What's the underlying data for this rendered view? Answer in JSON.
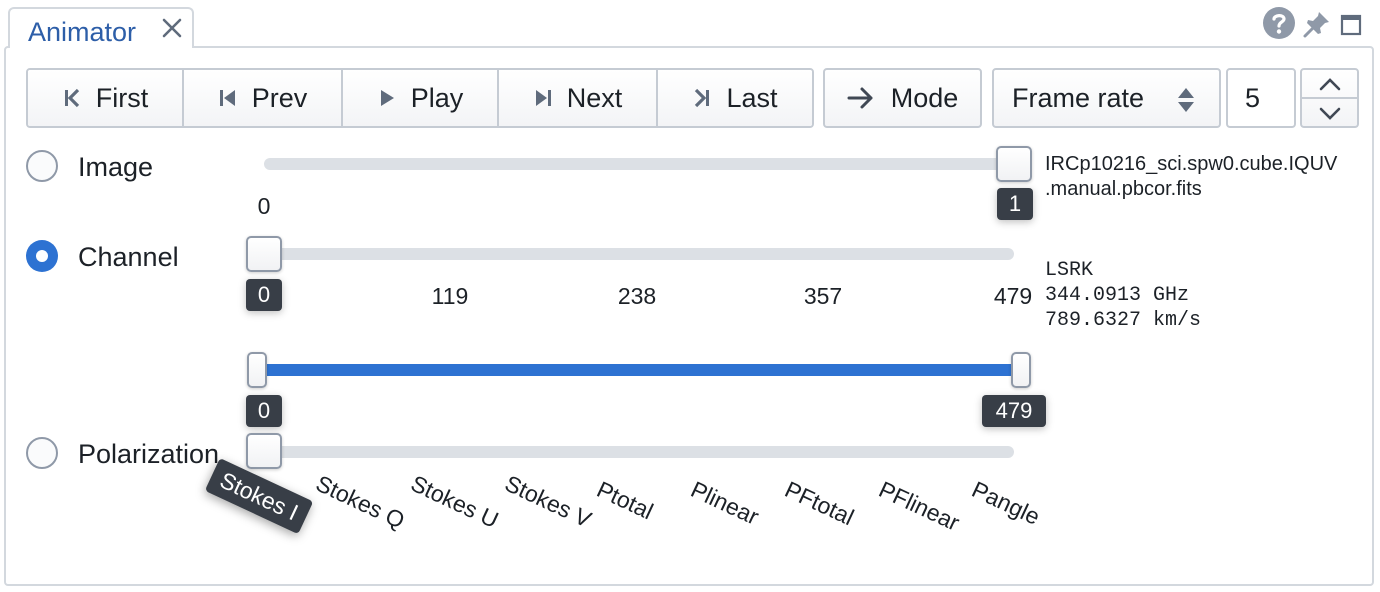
{
  "tab": {
    "title": "Animator",
    "close_icon": "close-icon"
  },
  "header_icons": [
    "help-icon",
    "pin-icon",
    "maximize-icon"
  ],
  "toolbar": {
    "buttons": [
      {
        "label": "First",
        "icon": "first-icon"
      },
      {
        "label": "Prev",
        "icon": "prev-icon"
      },
      {
        "label": "Play",
        "icon": "play-icon"
      },
      {
        "label": "Next",
        "icon": "next-icon"
      },
      {
        "label": "Last",
        "icon": "last-icon"
      }
    ],
    "mode_label": "Mode",
    "frame_rate_label": "Frame rate",
    "frame_rate_value": "5"
  },
  "image_row": {
    "label": "Image",
    "selected": false,
    "min_tick": "0",
    "current": "1",
    "filename_line1": "IRCp10216_sci.spw0.cube.IQUV",
    "filename_line2": ".manual.pbcor.fits"
  },
  "channel_row": {
    "label": "Channel",
    "selected": true,
    "current": "0",
    "ticks": [
      "119",
      "238",
      "357",
      "479"
    ],
    "frame": "LSRK",
    "frequency": "344.0913 GHz",
    "velocity": "789.6327 km/s",
    "range_min": "0",
    "range_max": "479"
  },
  "polarization_row": {
    "label": "Polarization",
    "selected": false,
    "current": "Stokes I",
    "options": [
      "Stokes Q",
      "Stokes U",
      "Stokes V",
      "Ptotal",
      "Plinear",
      "PFtotal",
      "PFlinear",
      "Pangle"
    ]
  },
  "colors": {
    "accent": "#2d72d2",
    "tab_text": "#2d5ea8",
    "badge_bg": "#383e47"
  }
}
